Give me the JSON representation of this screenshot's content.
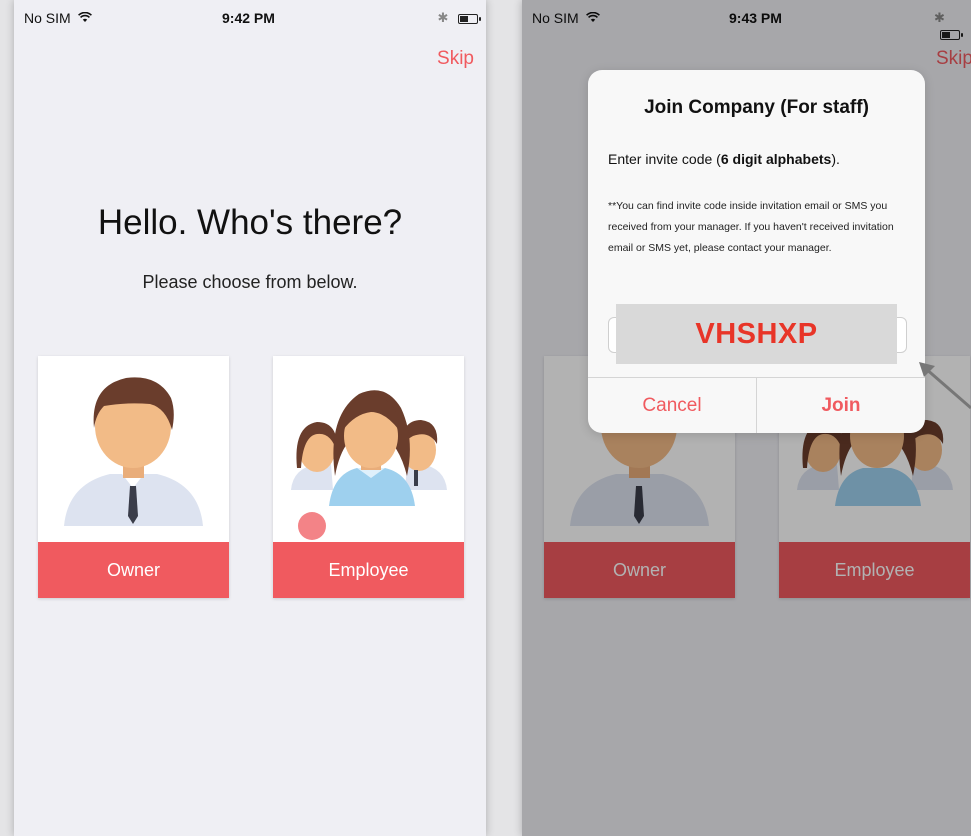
{
  "left": {
    "status": {
      "carrier": "No SIM",
      "time": "9:42 PM"
    },
    "skip": "Skip",
    "heading": "Hello. Who's there?",
    "subheading": "Please choose from below.",
    "cards": {
      "owner": "Owner",
      "employee": "Employee"
    }
  },
  "right": {
    "status": {
      "carrier": "No SIM",
      "time": "9:43 PM"
    },
    "skip": "Skip",
    "cards": {
      "owner": "Owner",
      "employee": "Employee"
    },
    "dialog": {
      "title": "Join Company (For staff)",
      "message_prefix": "Enter invite code (",
      "message_bold": "6 digit alphabets",
      "message_suffix": ").",
      "note": "**You can find invite code inside invitation email or SMS you received from your manager. If you haven't received invitation email or SMS yet, please contact your manager.",
      "invite_code": "VHSHXP",
      "cancel": "Cancel",
      "join": "Join"
    }
  },
  "colors": {
    "accent": "#f05a5f",
    "code_text": "#e83528",
    "background": "#efeff4"
  }
}
